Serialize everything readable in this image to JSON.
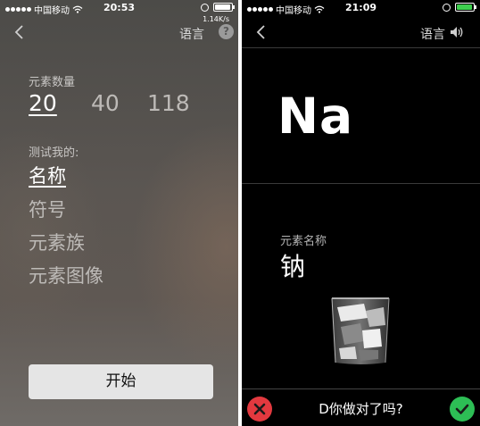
{
  "left": {
    "status": {
      "carrier": "中国移动",
      "time": "20:53",
      "net_speed": "1.14K/s"
    },
    "nav": {
      "back_icon": "chevron-left-icon",
      "language": "语言",
      "help_icon": "?"
    },
    "count_section": {
      "label": "元素数量",
      "options": [
        "20",
        "40",
        "118"
      ],
      "selected": "20"
    },
    "quiz_section": {
      "label": "测试我的:",
      "options": [
        "名称",
        "符号",
        "元素族",
        "元素图像"
      ],
      "selected": "名称"
    },
    "start_button": "开始"
  },
  "right": {
    "status": {
      "carrier": "中国移动",
      "time": "21:09",
      "battery_color": "#3ecf4f"
    },
    "nav": {
      "back_icon": "chevron-left-icon",
      "language": "语言",
      "speaker_icon": "speaker-icon"
    },
    "card": {
      "symbol": "Na",
      "name_label": "元素名称",
      "name_value": "钠",
      "image_icon": "sodium-in-water-glass-image"
    },
    "bottom": {
      "wrong_icon": "x-icon",
      "question": "D你做对了吗?",
      "right_icon": "checkmark-icon"
    }
  },
  "colors": {
    "wrong": "#e2393f",
    "right": "#2dbe55",
    "left_bg": "#5b5652"
  }
}
